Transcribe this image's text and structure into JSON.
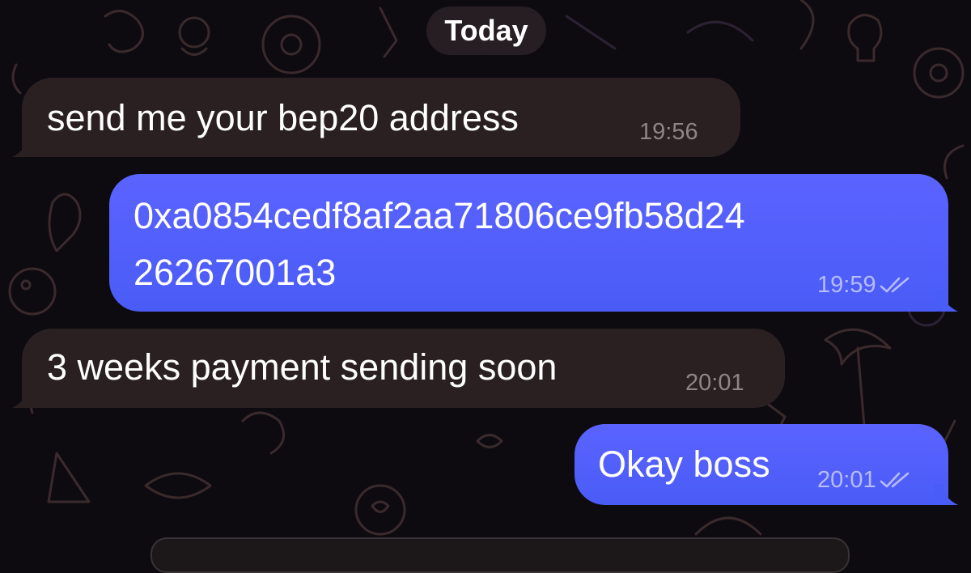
{
  "chat": {
    "date_label": "Today",
    "messages": [
      {
        "direction": "incoming",
        "text": "send me your bep20 address",
        "time": "19:56"
      },
      {
        "direction": "outgoing",
        "text_lines": [
          "0xa0854cedf8af2aa71806ce9fb58d24",
          "26267001a3"
        ],
        "time": "19:59",
        "status": "read"
      },
      {
        "direction": "incoming",
        "text": "3 weeks payment sending soon",
        "time": "20:01"
      },
      {
        "direction": "outgoing",
        "text": "Okay boss",
        "time": "20:01",
        "status": "read"
      }
    ]
  },
  "colors": {
    "background": "#0d0b10",
    "incoming_bubble": "#2a2022",
    "outgoing_bubble": "#5160fb",
    "incoming_time": "#8f8589",
    "outgoing_time": "#b6bcff"
  },
  "icons": {
    "read_receipt": "double-check-icon"
  }
}
